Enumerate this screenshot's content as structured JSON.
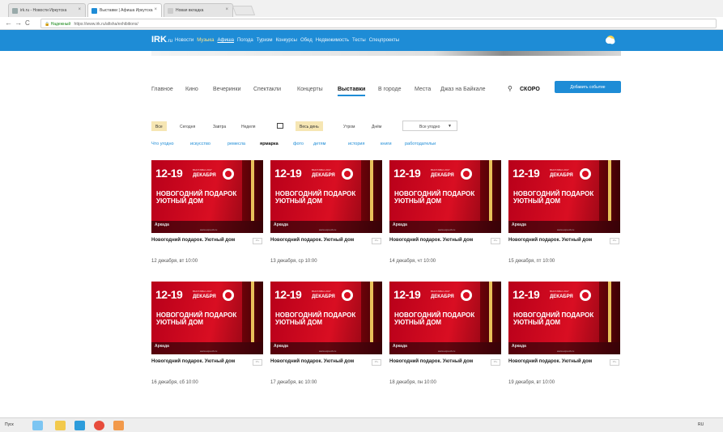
{
  "browser": {
    "tabs": [
      {
        "label": "irk.ru - Новости Иркутска",
        "active": false
      },
      {
        "label": "Выставки | Афиша Иркутска",
        "active": true
      },
      {
        "label": "Новая вкладка",
        "active": false
      }
    ],
    "back": "←",
    "forward": "→",
    "reload": "C",
    "secure_label": "Надежный",
    "url": "https://www.irk.ru/afisha/exhibitions/"
  },
  "site": {
    "logo": "IRK",
    "logo_suffix": ".ru",
    "topnav": [
      {
        "label": "Новости",
        "hl": false,
        "sel": false
      },
      {
        "label": "Музыка",
        "hl": true,
        "sel": false
      },
      {
        "label": "Афиша",
        "hl": false,
        "sel": true
      },
      {
        "label": "Погода",
        "hl": false,
        "sel": false
      },
      {
        "label": "Туризм",
        "hl": false,
        "sel": false
      },
      {
        "label": "Конкурсы",
        "hl": false,
        "sel": false
      },
      {
        "label": "Обед",
        "hl": false,
        "sel": false
      },
      {
        "label": "Недвижимость",
        "hl": false,
        "sel": false
      },
      {
        "label": "Тесты",
        "hl": false,
        "sel": false
      },
      {
        "label": "Спецпроекты",
        "hl": false,
        "sel": false
      }
    ],
    "weather_icon": "weather-icon"
  },
  "subnav": {
    "items": [
      "Главное",
      "Кино",
      "Вечеринки",
      "Спектакли",
      "Концерты",
      "Выставки",
      "В городе",
      "Места",
      "Джаз на Байкале"
    ],
    "active": "Выставки",
    "soon": "СКОРО",
    "add_button": "Добавить событие"
  },
  "filters": {
    "days": [
      "Все",
      "Сегодня",
      "Завтра",
      "Неделя"
    ],
    "active_day": "Все",
    "times": [
      "Весь день",
      "Утром",
      "Днём"
    ],
    "active_time": "Весь день",
    "select_value": "Все угодно"
  },
  "tags": {
    "items": [
      "Что угодно",
      "искусство",
      "ремесла",
      "ярмарка",
      "фото",
      "детям",
      "история",
      "книги",
      "работодательи"
    ],
    "active": "ярмарка"
  },
  "banner": {
    "dates": "12-19",
    "month": "ДЕКАБРЯ",
    "sub": "ВЫСТАВКА 2017",
    "headline": "НОВОГОДНИЙ ПОДАРОК УЮТНЫЙ ДОМ",
    "org": "Аркада",
    "site": "www.expo-irk.ru"
  },
  "cards": [
    {
      "title": "Новогодний подарок. Уютный дом",
      "date": "12 декабря, вт 10:00",
      "fav": "15+"
    },
    {
      "title": "Новогодний подарок. Уютный дом",
      "date": "13 декабря, ср 10:00",
      "fav": "15+"
    },
    {
      "title": "Новогодний подарок. Уютный дом",
      "date": "14 декабря, чт 10:00",
      "fav": "15+"
    },
    {
      "title": "Новогодний подарок. Уютный дом",
      "date": "15 декабря, пт 10:00",
      "fav": "15+"
    },
    {
      "title": "Новогодний подарок. Уютный дом",
      "date": "16 декабря, сб 10:00",
      "fav": "15+"
    },
    {
      "title": "Новогодний подарок. Уютный дом",
      "date": "17 декабря, вс 10:00",
      "fav": "15+"
    },
    {
      "title": "Новогодний подарок. Уютный дом",
      "date": "18 декабря, пн 10:00",
      "fav": "15+"
    },
    {
      "title": "Новогодний подарок. Уютный дом",
      "date": "19 декабря, вт 10:00",
      "fav": "15+"
    }
  ],
  "taskbar": {
    "start": "Пуск",
    "tray": "RU"
  },
  "colors": {
    "brand_blue": "#1e8cd6",
    "banner_red": "#d90e22",
    "filter_active": "#f6e6b3"
  }
}
